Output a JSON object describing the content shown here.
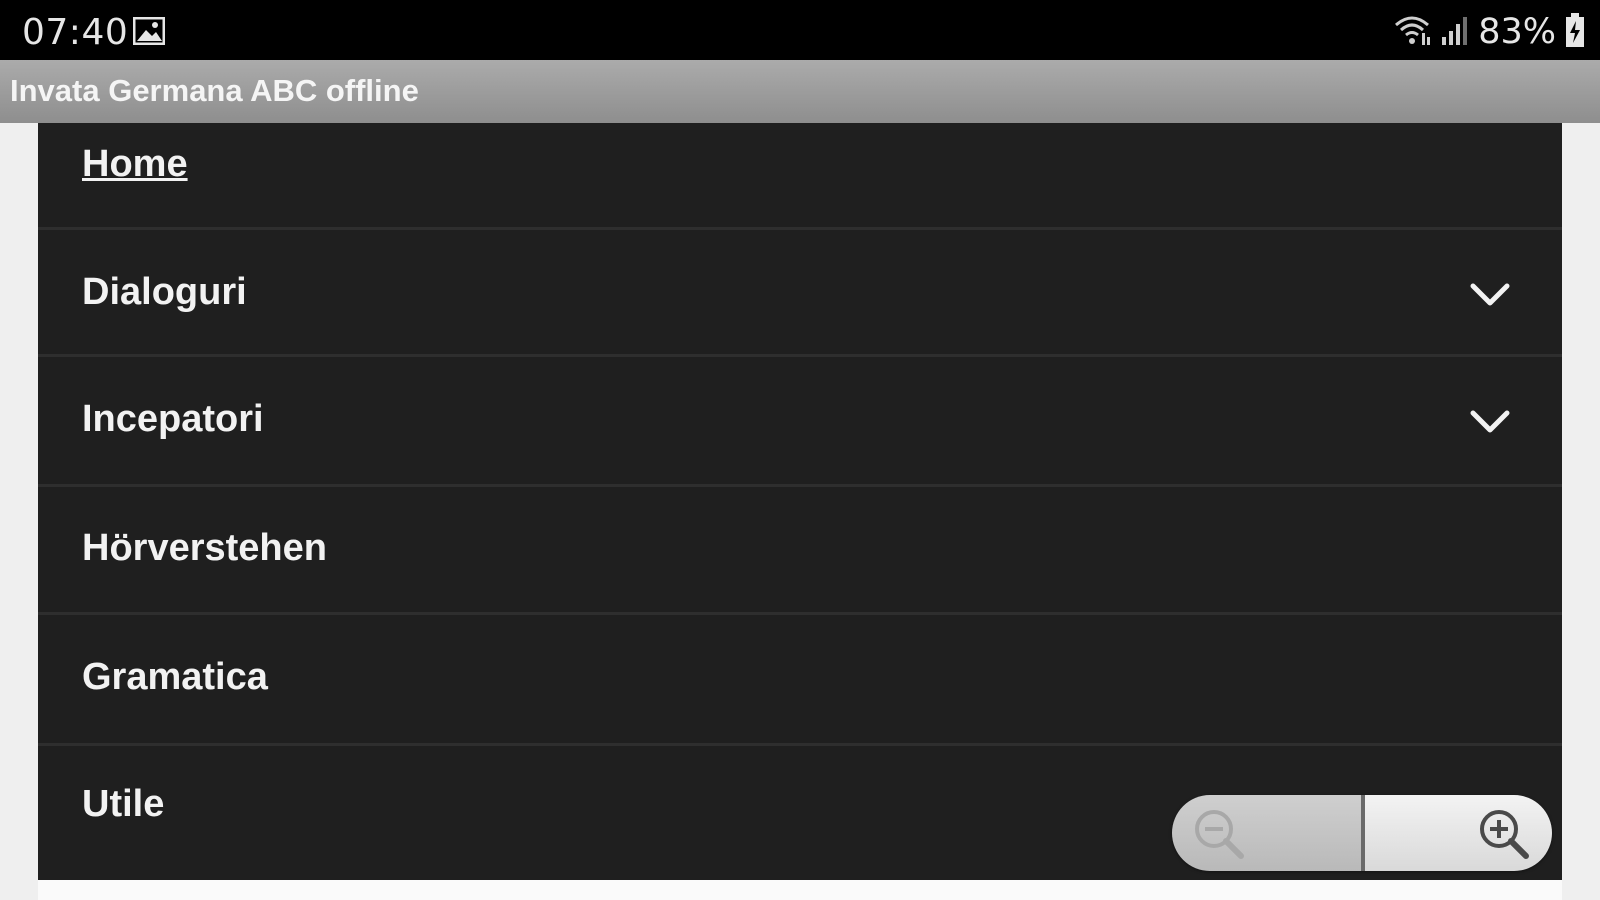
{
  "status_bar": {
    "time": "07:40",
    "battery_percent": "83%",
    "icons": [
      "gallery-icon",
      "wifi-icon",
      "signal-icon",
      "battery-charging-icon"
    ]
  },
  "app_bar": {
    "title": "Invata Germana ABC offline"
  },
  "menu": {
    "items": [
      {
        "label": "Home",
        "has_submenu": false,
        "active": true
      },
      {
        "label": "Dialoguri",
        "has_submenu": true
      },
      {
        "label": "Incepatori",
        "has_submenu": true
      },
      {
        "label": "Hörverstehen",
        "has_submenu": false
      },
      {
        "label": "Gramatica",
        "has_submenu": false
      },
      {
        "label": "Utile",
        "has_submenu": false
      }
    ]
  },
  "zoom": {
    "icons": [
      "zoom-out-icon",
      "zoom-in-icon"
    ],
    "zoom_out_enabled": false,
    "zoom_in_enabled": true
  },
  "colors": {
    "status_bar": "#000000",
    "app_bar": "#9e9e9e",
    "menu_background": "#1f1f1f",
    "menu_text": "#f2f2f2",
    "page_background": "#efefef"
  }
}
